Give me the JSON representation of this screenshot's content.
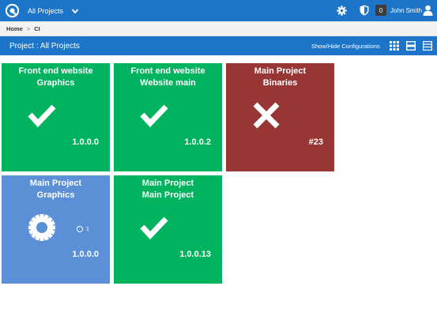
{
  "header": {
    "project_selector": "All Projects",
    "notifications_count": "0",
    "user_name": "John Smith"
  },
  "breadcrumb": {
    "home": "Home",
    "separator": ">",
    "current": "CI"
  },
  "page": {
    "title": "Project : All Projects",
    "toggle_configs": "Show/Hide Configurations"
  },
  "tiles": [
    {
      "line1": "Front end website",
      "line2": "Graphics",
      "status": "success",
      "value": "1.0.0.0"
    },
    {
      "line1": "Front end website",
      "line2": "Website main",
      "status": "success",
      "value": "1.0.0.2"
    },
    {
      "line1": "Main Project",
      "line2": "Binaries",
      "status": "failed",
      "value": "#23"
    },
    {
      "line1": "Main Project",
      "line2": "Graphics",
      "status": "building",
      "value": "1.0.0.0",
      "queued": "1"
    },
    {
      "line1": "Main Project",
      "line2": "Main Project",
      "status": "success",
      "value": "1.0.0.13"
    }
  ],
  "colors": {
    "accent": "#1c75c8",
    "success": "#00b35e",
    "failed": "#973634",
    "building": "#5b8fd6"
  },
  "icons": {
    "logo": "app-logo-icon",
    "settings": "gear-icon",
    "security": "shield-icon",
    "user": "user-icon",
    "view_tiles": "grid-view-icon",
    "view_list": "list-view-icon",
    "view_table": "table-view-icon"
  }
}
